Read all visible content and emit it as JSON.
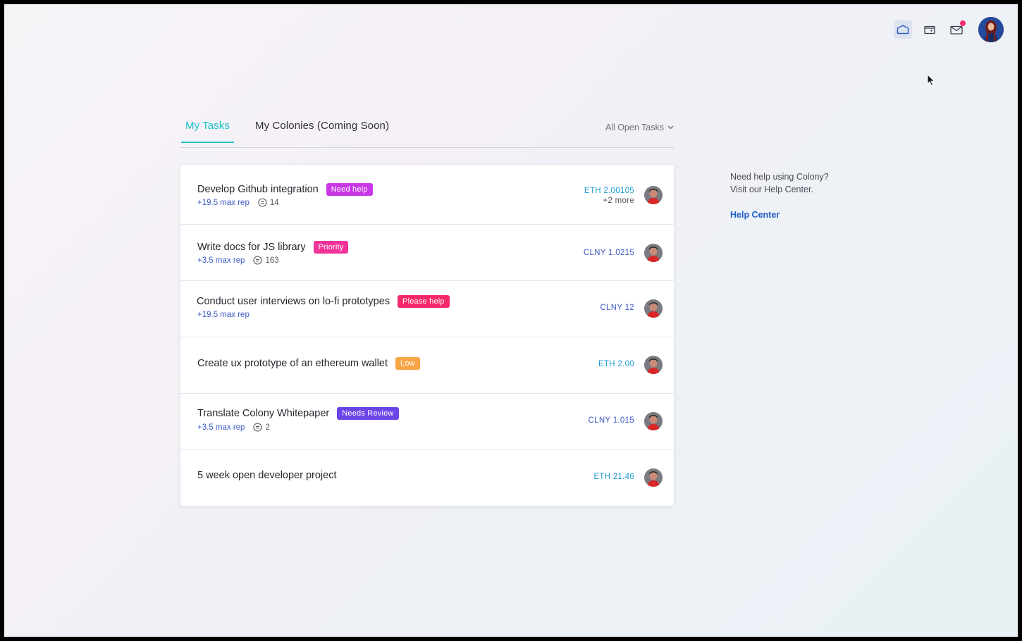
{
  "nav": {
    "items": [
      {
        "name": "dashboard",
        "active": true
      },
      {
        "name": "wallet",
        "active": false
      },
      {
        "name": "inbox",
        "active": false,
        "has_notification": true
      }
    ]
  },
  "tabs": {
    "my_tasks": "My Tasks",
    "my_colonies": "My Colonies",
    "my_colonies_suffix": "(Coming Soon)",
    "filter": "All Open Tasks"
  },
  "tasks": [
    {
      "title": "Develop Github integration",
      "tag": "Need help",
      "tag_color": "#c936e6",
      "rep": "+19.5 max rep",
      "comments": "14",
      "amount": "ETH 2.00105",
      "amount_color": "#1e9bd3",
      "more": "+2 more"
    },
    {
      "title": "Write docs for JS library",
      "tag": "Priority",
      "tag_color": "#f2339a",
      "rep": "+3.5 max rep",
      "comments": "163",
      "amount": "CLNY 1.0215",
      "amount_color": "#3e5ac4"
    },
    {
      "title": "Conduct user interviews on lo-fi prototypes",
      "tag": "Please help",
      "tag_color": "#f5296a",
      "rep": "+19.5 max rep",
      "amount": "CLNY 12",
      "amount_color": "#3e5ac4"
    },
    {
      "title": "Create ux prototype of an ethereum wallet",
      "tag": "Low",
      "tag_color": "#f8a548",
      "amount": "ETH 2.00",
      "amount_color": "#1e9bd3"
    },
    {
      "title": "Translate Colony Whitepaper",
      "tag": "Needs Review",
      "tag_color": "#6d44e6",
      "rep": "+3.5 max rep",
      "comments": "2",
      "amount": "CLNY 1.015",
      "amount_color": "#3e5ac4"
    },
    {
      "title": "5 week open developer project",
      "amount": "ETH 21.46",
      "amount_color": "#1e9bd3"
    }
  ],
  "help": {
    "line1": "Need help using Colony?",
    "line2": "Visit our Help Center.",
    "link": "Help Center"
  }
}
